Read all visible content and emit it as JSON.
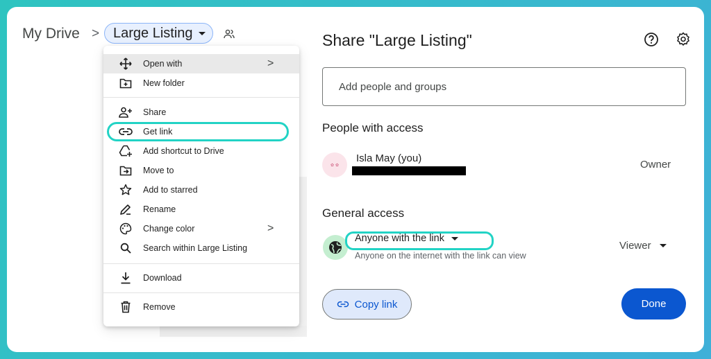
{
  "breadcrumb": {
    "root": "My Drive",
    "separator": ">",
    "current": "Large Listing"
  },
  "menu": {
    "items": [
      {
        "label": "Open with",
        "icon": "move-arrows-icon",
        "has_submenu": true,
        "highlighted": true
      },
      {
        "label": "New folder",
        "icon": "new-folder-icon"
      },
      {
        "label": "Share",
        "icon": "person-add-icon"
      },
      {
        "label": "Get link",
        "icon": "link-icon",
        "annotated": true
      },
      {
        "label": "Add shortcut to Drive",
        "icon": "add-shortcut-icon"
      },
      {
        "label": "Move to",
        "icon": "move-to-icon"
      },
      {
        "label": "Add to starred",
        "icon": "star-icon"
      },
      {
        "label": "Rename",
        "icon": "pencil-icon"
      },
      {
        "label": "Change color",
        "icon": "palette-icon",
        "has_submenu": true
      },
      {
        "label": "Search within Large Listing",
        "icon": "search-icon"
      },
      {
        "label": "Download",
        "icon": "download-icon"
      },
      {
        "label": "Remove",
        "icon": "trash-icon"
      }
    ],
    "submenu_chevron": ">"
  },
  "share": {
    "title": "Share \"Large Listing\"",
    "add_people_placeholder": "Add people and groups",
    "people_heading": "People with access",
    "user": {
      "name": "Isla May (you)",
      "role": "Owner"
    },
    "general_heading": "General access",
    "access_level": "Anyone with the link",
    "access_desc": "Anyone on the internet with the link can view",
    "permission": "Viewer",
    "copy_link": "Copy link",
    "done": "Done"
  },
  "colors": {
    "background_teal": "#2ec4c0",
    "annotation": "#22d3c5",
    "primary_blue": "#0b57d0",
    "copy_link_bg": "#dfe9fb",
    "globe_bg": "#c4eed0"
  }
}
